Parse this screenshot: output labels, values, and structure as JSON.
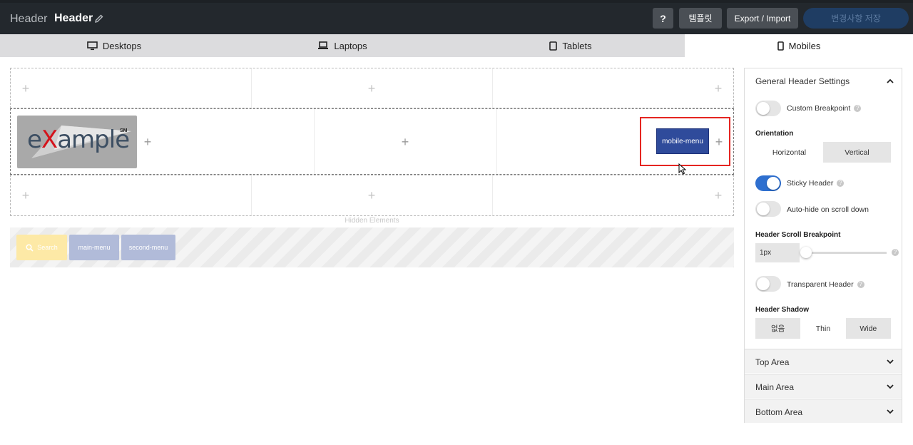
{
  "topbar": {
    "crumb": "Header",
    "title": "Header",
    "help_label": "?",
    "template_label": "템플릿",
    "export_label": "Export / Import",
    "save_label": "변경사항 저장"
  },
  "device_tabs": [
    {
      "label": "Desktops",
      "icon": "monitor-icon"
    },
    {
      "label": "Laptops",
      "icon": "laptop-icon"
    },
    {
      "label": "Tablets",
      "icon": "tablet-icon"
    },
    {
      "label": "Mobiles",
      "icon": "mobile-icon",
      "active": true
    }
  ],
  "builder": {
    "logo": {
      "prefix": "e",
      "x": "X",
      "suffix": "ample",
      "mark": "SM"
    },
    "mobile_menu_label": "mobile-menu",
    "hidden_label": "Hidden Elements",
    "hidden_items": [
      "Search",
      "main-menu",
      "second-menu"
    ],
    "plus": "+"
  },
  "panel": {
    "title": "General Header Settings",
    "custom_breakpoint": "Custom Breakpoint",
    "orientation_label": "Orientation",
    "orientation_options": [
      "Horizontal",
      "Vertical"
    ],
    "orientation_selected": "Horizontal",
    "sticky_header": "Sticky Header",
    "auto_hide": "Auto-hide on scroll down",
    "scroll_breakpoint_label": "Header Scroll Breakpoint",
    "scroll_breakpoint_value": "1px",
    "transparent_header": "Transparent Header",
    "shadow_label": "Header Shadow",
    "shadow_options": [
      "없음",
      "Thin",
      "Wide"
    ],
    "shadow_selected": "Thin",
    "sections": [
      "Top Area",
      "Main Area",
      "Bottom Area"
    ],
    "help": "?"
  },
  "colors": {
    "topbar": "#23282d",
    "accent": "#2e6fcf",
    "highlight": "#e52521",
    "mobile_menu_btn": "#2f4b9b"
  }
}
